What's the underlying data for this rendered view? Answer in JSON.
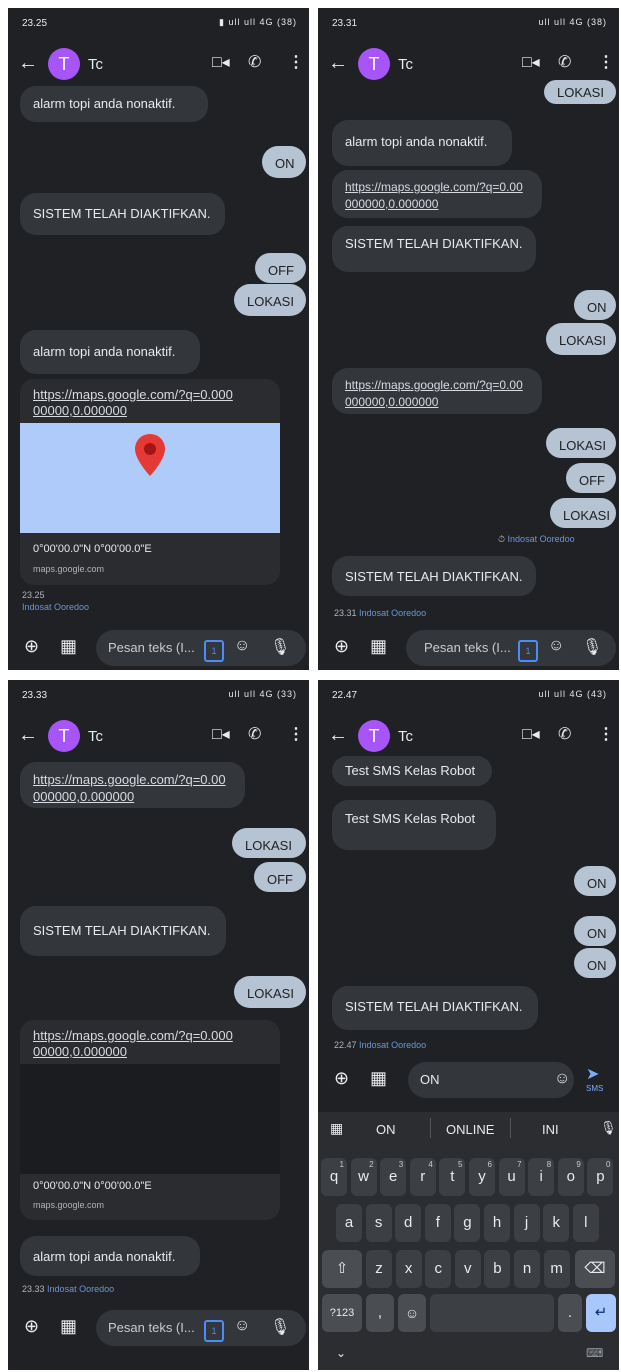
{
  "panels": [
    {
      "status_time": "23.25",
      "status_icons": "▮ ull ull 4G (38)",
      "contact_initial": "T",
      "contact_name": "Tc",
      "messages": {
        "m1": "alarm topi anda nonaktif.",
        "m2": "ON",
        "m3": "SISTEM TELAH DIAKTIFKAN.",
        "m4": "OFF",
        "m5": "LOKASI",
        "m6": "alarm topi anda nonaktif.",
        "link": "https://maps.google.com/?q=0.00000000,0.000000",
        "coords": "0°00'00.0\"N 0°00'00.0\"E",
        "domain": "maps.google.com"
      },
      "footer_time": "23.25",
      "footer_carrier": "Indosat Ooredoo",
      "input_placeholder": "Pesan teks (I...",
      "sim": "1"
    },
    {
      "status_time": "23.31",
      "status_icons": "ull ull 4G (38)",
      "contact_initial": "T",
      "contact_name": "Tc",
      "messages": {
        "m1": "LOKASI",
        "m2": "alarm topi anda nonaktif.",
        "link": "https://maps.google.com/?q=0.00000000,0.000000",
        "m3": "SISTEM TELAH DIAKTIFKAN.",
        "m4": "ON",
        "m5": "LOKASI",
        "link2": "https://maps.google.com/?q=0.00000000,0.000000",
        "m6": "LOKASI",
        "m7": "OFF",
        "m8": "LOKASI",
        "m9": "SISTEM TELAH DIAKTIFKAN."
      },
      "sent_carrier": "Indosat Ooredoo",
      "footer_time": "23.31",
      "footer_carrier": "Indosat Ooredoo",
      "input_placeholder": "Pesan teks (I...",
      "sim": "1"
    },
    {
      "status_time": "23.33",
      "status_icons": "ull ull 4G (33)",
      "contact_initial": "T",
      "contact_name": "Tc",
      "messages": {
        "link": "https://maps.google.com/?q=0.00000000,0.000000",
        "m1": "LOKASI",
        "m2": "OFF",
        "m3": "SISTEM TELAH DIAKTIFKAN.",
        "m4": "LOKASI",
        "link2": "https://maps.google.com/?q=0.00000000,0.000000",
        "coords": "0°00'00.0\"N 0°00'00.0\"E",
        "domain": "maps.google.com",
        "m5": "alarm topi anda nonaktif."
      },
      "footer_time": "23.33",
      "footer_carrier": "Indosat Ooredoo",
      "input_placeholder": "Pesan teks (I...",
      "sim": "1"
    },
    {
      "status_time": "22.47",
      "status_icons": "ull ull 4G (43)",
      "contact_initial": "T",
      "contact_name": "Tc",
      "messages": {
        "m1": "Test SMS Kelas Robot",
        "m2": "Test SMS Kelas Robot",
        "m3": "ON",
        "m4": "ON",
        "m5": "ON",
        "m6": "SISTEM TELAH DIAKTIFKAN."
      },
      "footer_time": "22.47",
      "footer_carrier": "Indosat Ooredoo",
      "input_value": "ON",
      "send_label": "SMS",
      "suggestions": [
        "ON",
        "ONLINE",
        "INI"
      ],
      "row1": [
        "q",
        "w",
        "e",
        "r",
        "t",
        "y",
        "u",
        "i",
        "o",
        "p"
      ],
      "row1_hints": [
        "1",
        "2",
        "3",
        "4",
        "5",
        "6",
        "7",
        "8",
        "9",
        "0"
      ],
      "row2": [
        "a",
        "s",
        "d",
        "f",
        "g",
        "h",
        "j",
        "k",
        "l"
      ],
      "row3": [
        "z",
        "x",
        "c",
        "v",
        "b",
        "n",
        "m"
      ],
      "num_key": "?123",
      "comma_key": ",",
      "period_key": "."
    }
  ],
  "colors": {
    "bg": "#1f2125",
    "incoming": "#33363b",
    "outgoing": "#b6c3d3",
    "accent": "#a855f7",
    "map_bg": "#aecbfa",
    "pin": "#e53935"
  },
  "icons": [
    "back-arrow-icon",
    "video-call-icon",
    "phone-icon",
    "more-vert-icon",
    "add-circle-icon",
    "gallery-icon",
    "emoji-icon",
    "mic-icon",
    "send-icon",
    "sim-icon"
  ]
}
